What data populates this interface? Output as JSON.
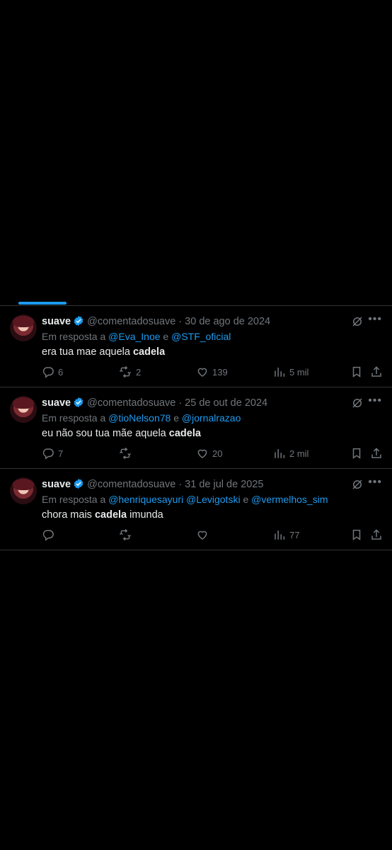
{
  "tweets": [
    {
      "name": "suave",
      "handle": "@comentadosuave",
      "date": "· 30 de ago de 2024",
      "reply_prefix": "Em resposta a ",
      "mentions": [
        "@Eva_Inoe",
        "@STF_oficial"
      ],
      "sep1": " e ",
      "sep2": "",
      "text_before": "era tua mae aquela ",
      "text_bold": "cadela",
      "text_after": "",
      "replies": "6",
      "retweets": "2",
      "likes": "139",
      "views": "5 mil"
    },
    {
      "name": "suave",
      "handle": "@comentadosuave",
      "date": "· 25 de out de 2024",
      "reply_prefix": "Em resposta a ",
      "mentions": [
        "@tioNelson78",
        "@jornalrazao"
      ],
      "sep1": " e ",
      "sep2": "",
      "text_before": "eu não sou tua mãe aquela ",
      "text_bold": "cadela",
      "text_after": "",
      "replies": "7",
      "retweets": "",
      "likes": "20",
      "views": "2 mil"
    },
    {
      "name": "suave",
      "handle": "@comentadosuave",
      "date": "· 31 de jul de 2025",
      "reply_prefix": "Em resposta a ",
      "mentions": [
        "@henriquesayuri",
        "@Levigotski",
        "@vermelhos_sim"
      ],
      "sep1": " ",
      "sep2": " e ",
      "text_before": "chora mais ",
      "text_bold": "cadela",
      "text_after": " imunda",
      "replies": "",
      "retweets": "",
      "likes": "",
      "views": "77"
    }
  ],
  "colors": {
    "accent": "#1d9bf0",
    "muted": "#71767b",
    "text": "#e7e9ea",
    "border": "#2f3336"
  },
  "icons": [
    "reply-icon",
    "retweet-icon",
    "like-icon",
    "views-icon",
    "bookmark-icon",
    "share-icon",
    "grok-icon",
    "more-icon",
    "verified-icon"
  ]
}
